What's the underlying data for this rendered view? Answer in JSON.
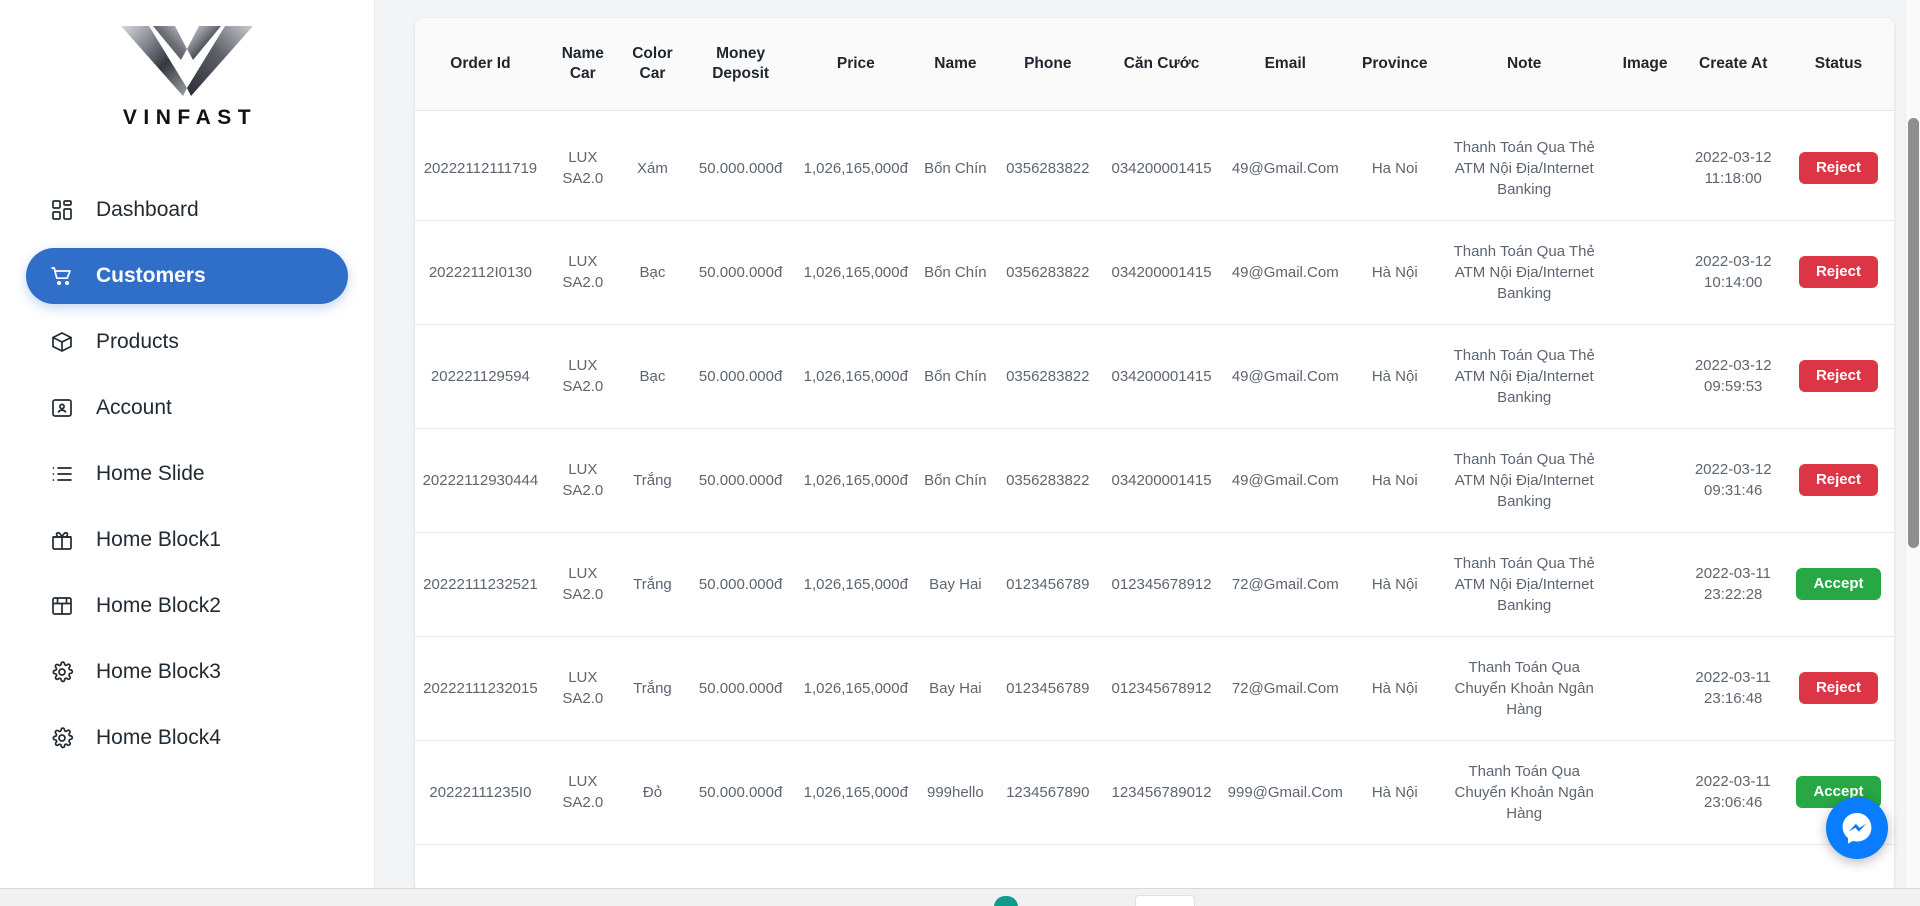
{
  "brand": {
    "wordmark": "VINFAST",
    "logo_icon": "vinfast-v-logo"
  },
  "sidebar": {
    "items": [
      {
        "label": "Dashboard",
        "icon": "grid-icon",
        "active": false
      },
      {
        "label": "Customers",
        "icon": "cart-icon",
        "active": true
      },
      {
        "label": "Products",
        "icon": "box-icon",
        "active": false
      },
      {
        "label": "Account",
        "icon": "id-card-icon",
        "active": false
      },
      {
        "label": "Home Slide",
        "icon": "list-icon",
        "active": false
      },
      {
        "label": "Home Block1",
        "icon": "gift-icon",
        "active": false
      },
      {
        "label": "Home Block2",
        "icon": "window-icon",
        "active": false
      },
      {
        "label": "Home Block3",
        "icon": "gear-icon",
        "active": false
      },
      {
        "label": "Home Block4",
        "icon": "gear-icon",
        "active": false
      }
    ]
  },
  "table": {
    "columns": [
      "Order Id",
      "Name Car",
      "Color Car",
      "Money Deposit",
      "Price",
      "Name",
      "Phone",
      "Căn Cước",
      "Email",
      "Province",
      "Note",
      "Image",
      "Create At",
      "Status"
    ],
    "rows": [
      {
        "order_id": "20222112111719",
        "name_car": "LUX SA2.0",
        "color_car": "Xám",
        "money_deposit": "50.000.000đ",
        "price": "1,026,165,000đ",
        "name": "Bốn Chín",
        "phone": "0356283822",
        "can_cuoc": "034200001415",
        "email": "49@Gmail.Com",
        "province": "Ha Noi",
        "note": "Thanh Toán Qua Thẻ ATM Nội Địa/Internet Banking",
        "image": "",
        "create_at": "2022-03-12 11:18:00",
        "status": "Reject"
      },
      {
        "order_id": "20222112I0130",
        "name_car": "LUX SA2.0",
        "color_car": "Bạc",
        "money_deposit": "50.000.000đ",
        "price": "1,026,165,000đ",
        "name": "Bốn Chín",
        "phone": "0356283822",
        "can_cuoc": "034200001415",
        "email": "49@Gmail.Com",
        "province": "Hà Nội",
        "note": "Thanh Toán Qua Thẻ ATM Nội Địa/Internet Banking",
        "image": "",
        "create_at": "2022-03-12 10:14:00",
        "status": "Reject"
      },
      {
        "order_id": "202221129594",
        "name_car": "LUX SA2.0",
        "color_car": "Bạc",
        "money_deposit": "50.000.000đ",
        "price": "1,026,165,000đ",
        "name": "Bốn Chín",
        "phone": "0356283822",
        "can_cuoc": "034200001415",
        "email": "49@Gmail.Com",
        "province": "Hà Nội",
        "note": "Thanh Toán Qua Thẻ ATM Nội Địa/Internet Banking",
        "image": "",
        "create_at": "2022-03-12 09:59:53",
        "status": "Reject"
      },
      {
        "order_id": "20222112930444",
        "name_car": "LUX SA2.0",
        "color_car": "Trắng",
        "money_deposit": "50.000.000đ",
        "price": "1,026,165,000đ",
        "name": "Bốn Chín",
        "phone": "0356283822",
        "can_cuoc": "034200001415",
        "email": "49@Gmail.Com",
        "province": "Ha Noi",
        "note": "Thanh Toán Qua Thẻ ATM Nội Địa/Internet Banking",
        "image": "",
        "create_at": "2022-03-12 09:31:46",
        "status": "Reject"
      },
      {
        "order_id": "20222111232521",
        "name_car": "LUX SA2.0",
        "color_car": "Trắng",
        "money_deposit": "50.000.000đ",
        "price": "1,026,165,000đ",
        "name": "Bay Hai",
        "phone": "0123456789",
        "can_cuoc": "012345678912",
        "email": "72@Gmail.Com",
        "province": "Hà Nội",
        "note": "Thanh Toán Qua Thẻ ATM Nội Địa/Internet Banking",
        "image": "",
        "create_at": "2022-03-11 23:22:28",
        "status": "Accept"
      },
      {
        "order_id": "20222111232015",
        "name_car": "LUX SA2.0",
        "color_car": "Trắng",
        "money_deposit": "50.000.000đ",
        "price": "1,026,165,000đ",
        "name": "Bay Hai",
        "phone": "0123456789",
        "can_cuoc": "012345678912",
        "email": "72@Gmail.Com",
        "province": "Hà Nội",
        "note": "Thanh Toán Qua Chuyển Khoản Ngân Hàng",
        "image": "",
        "create_at": "2022-03-11 23:16:48",
        "status": "Reject"
      },
      {
        "order_id": "20222111235I0",
        "name_car": "LUX SA2.0",
        "color_car": "Đỏ",
        "money_deposit": "50.000.000đ",
        "price": "1,026,165,000đ",
        "name": "999hello",
        "phone": "1234567890",
        "can_cuoc": "123456789012",
        "email": "999@Gmail.Com",
        "province": "Hà Nội",
        "note": "Thanh Toán Qua Chuyển Khoản Ngân Hàng",
        "image": "",
        "create_at": "2022-03-11 23:06:46",
        "status": "Accept"
      }
    ]
  },
  "widgets": {
    "messenger_icon": "messenger-icon"
  },
  "colors": {
    "accent": "#2f6fc9",
    "reject": "#dc3545",
    "accept": "#28a745",
    "messenger": "#0a7cff"
  }
}
